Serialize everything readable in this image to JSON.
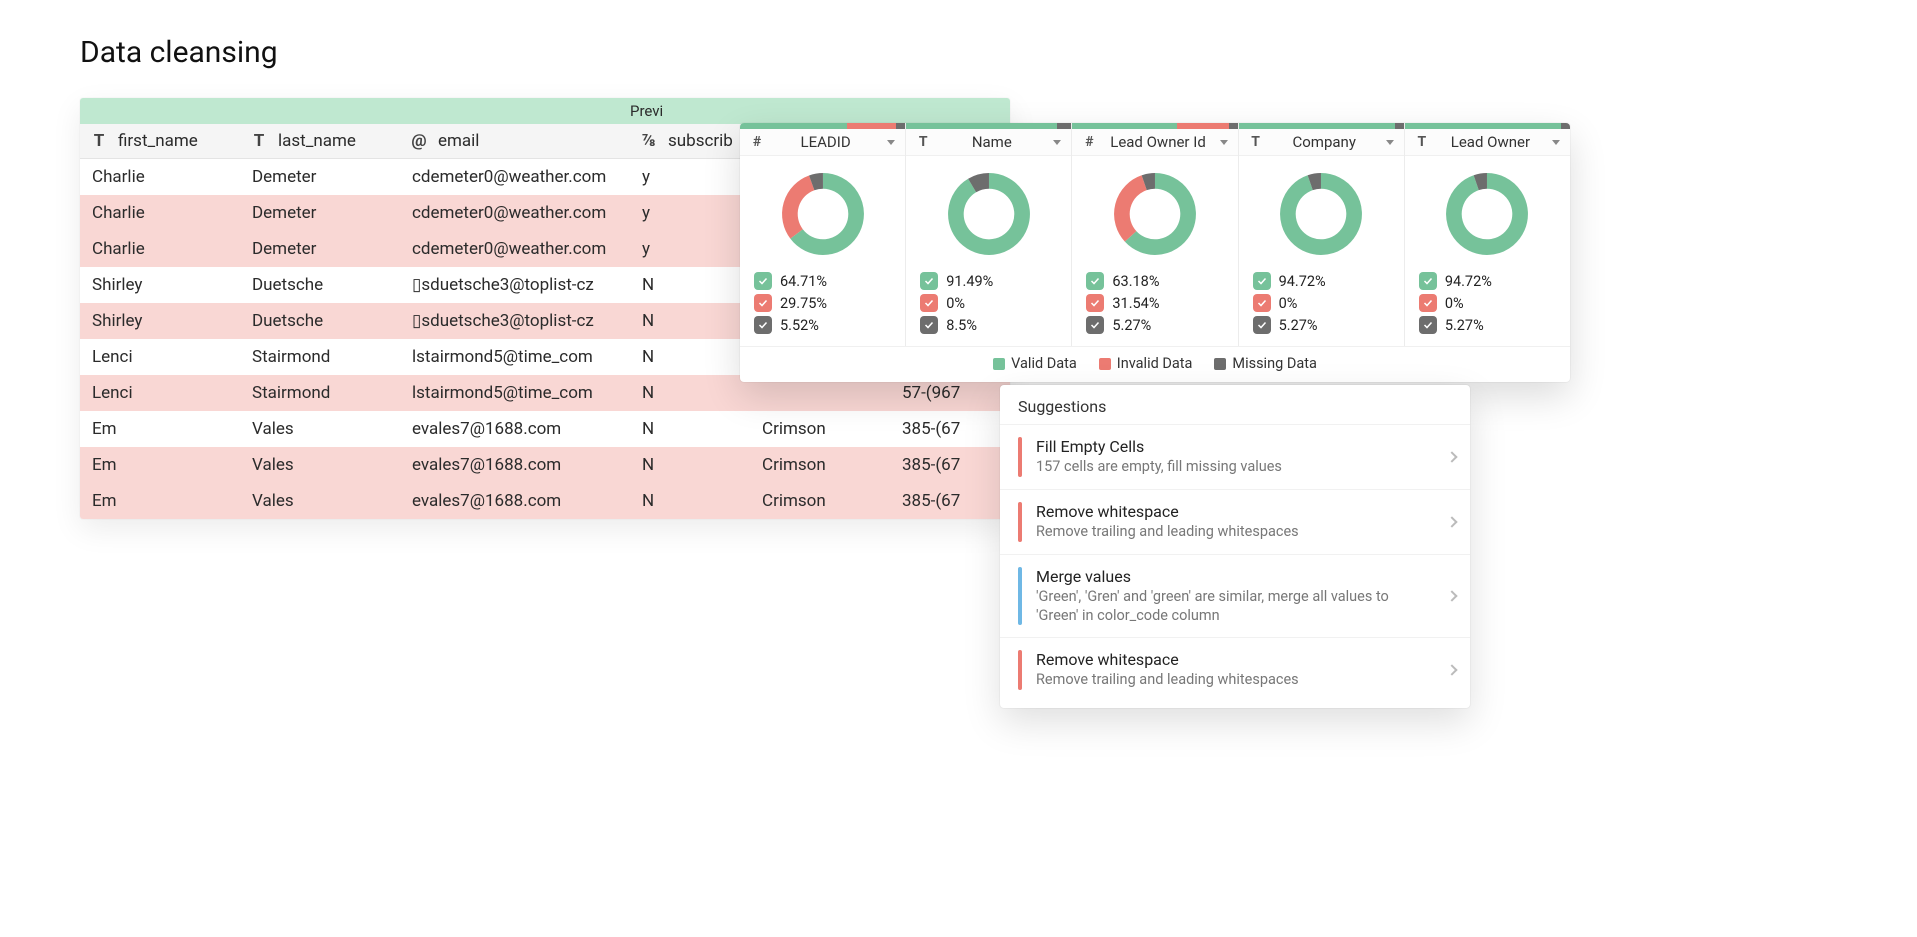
{
  "title": "Data cleansing",
  "preview_label": "Previ",
  "colors": {
    "valid": "#76c29a",
    "invalid": "#ec7b72",
    "missing": "#6d6d6d"
  },
  "sheet": {
    "columns": [
      {
        "icon": "T",
        "label": "first_name"
      },
      {
        "icon": "T",
        "label": "last_name"
      },
      {
        "icon": "@",
        "label": "email"
      },
      {
        "icon": "⅞",
        "label": "subscrib"
      },
      {
        "icon": "",
        "label": ""
      },
      {
        "icon": "",
        "label": ""
      }
    ],
    "rows": [
      {
        "dup": false,
        "c": [
          "Charlie",
          "Demeter",
          "cdemeter0@weather.com",
          "y",
          "",
          ""
        ]
      },
      {
        "dup": true,
        "c": [
          "Charlie",
          "Demeter",
          "cdemeter0@weather.com",
          "y",
          "",
          ""
        ]
      },
      {
        "dup": true,
        "c": [
          "Charlie",
          "Demeter",
          "cdemeter0@weather.com",
          "y",
          "",
          ""
        ]
      },
      {
        "dup": false,
        "c": [
          "Shirley",
          "Duetsche",
          "▯sduetsche3@toplist-cz",
          "N",
          "",
          ""
        ]
      },
      {
        "dup": true,
        "c": [
          "Shirley",
          "Duetsche",
          "▯sduetsche3@toplist-cz",
          "N",
          "",
          ""
        ]
      },
      {
        "dup": false,
        "c": [
          "Lenci",
          "Stairmond",
          "lstairmond5@time_com",
          "N",
          "",
          "57-(967"
        ]
      },
      {
        "dup": true,
        "c": [
          "Lenci",
          "Stairmond",
          "lstairmond5@time_com",
          "N",
          "",
          "57-(967"
        ]
      },
      {
        "dup": false,
        "c": [
          "Em",
          "Vales",
          "evales7@1688.com",
          "N",
          "Crimson",
          "385-(67"
        ]
      },
      {
        "dup": true,
        "c": [
          "Em",
          "Vales",
          "evales7@1688.com",
          "N",
          "Crimson",
          "385-(67"
        ]
      },
      {
        "dup": true,
        "c": [
          "Em",
          "Vales",
          "evales7@1688.com",
          "N",
          "Crimson",
          "385-(67"
        ]
      }
    ]
  },
  "chart_data": {
    "type": "pie",
    "title": "Column data-quality breakdown",
    "series_legend": [
      "Valid Data",
      "Invalid Data",
      "Missing Data"
    ],
    "columns": [
      {
        "type_icon": "#",
        "name": "LEADID",
        "valid": 64.71,
        "invalid": 29.75,
        "missing": 5.52
      },
      {
        "type_icon": "T",
        "name": "Name",
        "valid": 91.49,
        "invalid": 0,
        "missing": 8.5
      },
      {
        "type_icon": "#",
        "name": "Lead Owner Id",
        "valid": 63.18,
        "invalid": 31.54,
        "missing": 5.27
      },
      {
        "type_icon": "T",
        "name": "Company",
        "valid": 94.72,
        "invalid": 0,
        "missing": 5.27
      },
      {
        "type_icon": "T",
        "name": "Lead Owner",
        "valid": 94.72,
        "invalid": 0,
        "missing": 5.27
      }
    ]
  },
  "legend": {
    "valid": "Valid Data",
    "invalid": "Invalid Data",
    "missing": "Missing Data"
  },
  "suggestions": {
    "title": "Suggestions",
    "items": [
      {
        "color": "red",
        "title": "Fill Empty Cells",
        "desc": "157 cells are empty, fill missing values"
      },
      {
        "color": "red",
        "title": "Remove whitespace",
        "desc": "Remove trailing and leading whitespaces"
      },
      {
        "color": "blue",
        "title": "Merge values",
        "desc": "'Green', 'Gren' and 'green' are similar, merge all values to 'Green' in color_code column"
      },
      {
        "color": "red",
        "title": "Remove whitespace",
        "desc": "Remove trailing and leading whitespaces"
      }
    ]
  }
}
